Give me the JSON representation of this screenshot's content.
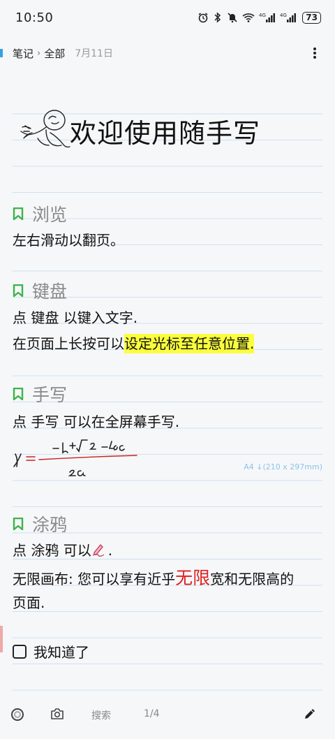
{
  "status": {
    "time": "10:50",
    "battery": "73",
    "icons": [
      "alarm-icon",
      "bluetooth-icon",
      "mute-icon",
      "wifi-icon",
      "signal-4g-icon",
      "signal-4g-icon"
    ]
  },
  "topbar": {
    "notebook": "笔记",
    "separator": "›",
    "folder": "全部",
    "date": "7月11日"
  },
  "page": {
    "title": "欢迎使用随手写",
    "a4_label": "A4 ↓(210 x 297mm)",
    "sections": [
      {
        "heading": "浏览",
        "lines": [
          "左右滑动以翻页。"
        ]
      },
      {
        "heading": "键盘",
        "lines": [
          "点 键盘 以键入文字.",
          "在页面上长按可以",
          "设定光标至任意位置."
        ]
      },
      {
        "heading": "手写",
        "lines": [
          "点 手写 可以在全屏幕手写."
        ]
      },
      {
        "heading": "涂鸦",
        "lines": [
          "点 涂鸦 可以",
          ".",
          "无限画布: 您可以享有近乎",
          "无限",
          "宽和无限高的",
          "页面."
        ]
      }
    ],
    "checkbox_label": "我知道了"
  },
  "bottombar": {
    "search": "搜索",
    "page_indicator": "1/4"
  },
  "colors": {
    "accent_green": "#3cb44a",
    "highlight": "#fbff3d",
    "red": "#e02020",
    "rule_line": "#cfe0ee"
  }
}
